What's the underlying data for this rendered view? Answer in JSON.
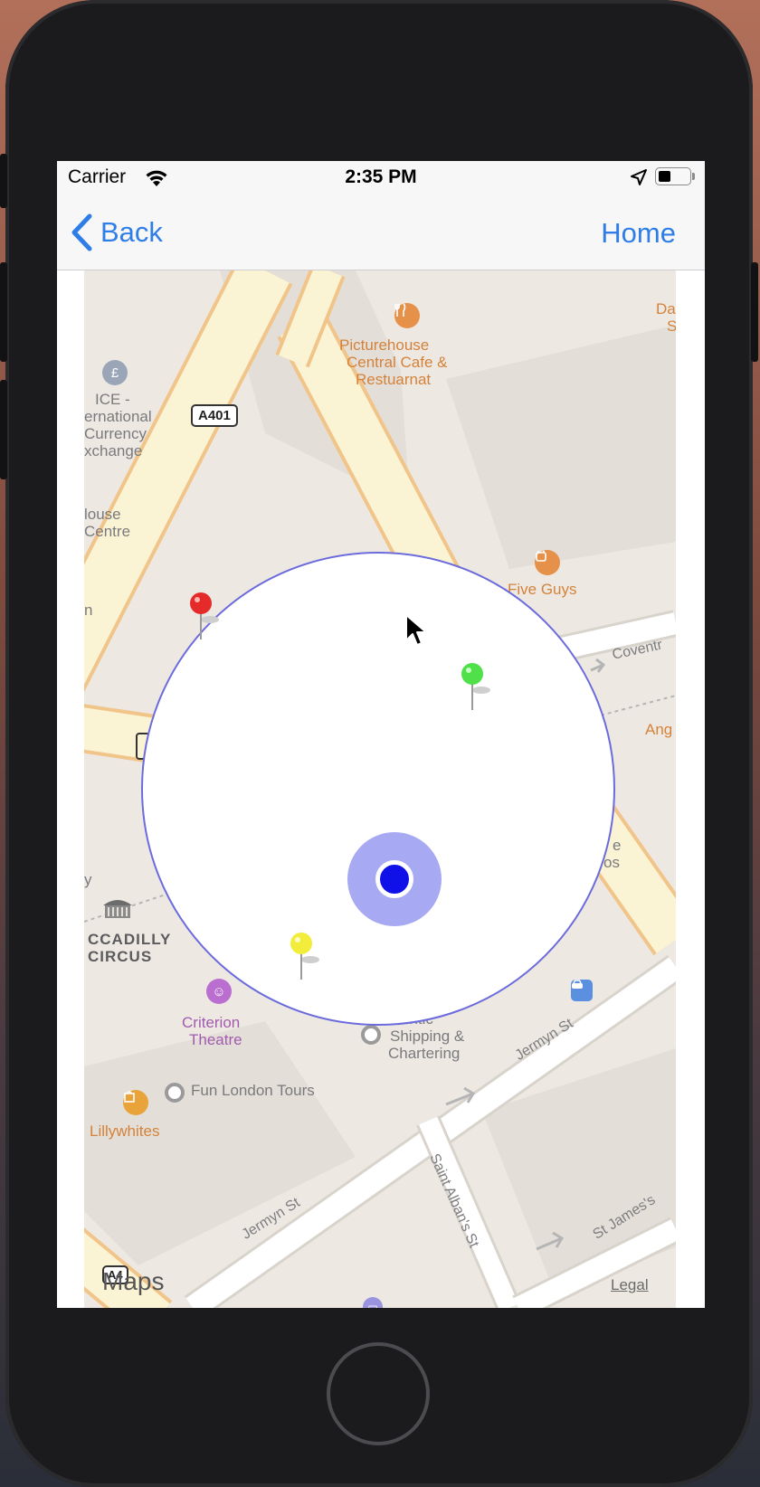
{
  "status_bar": {
    "carrier": "Carrier",
    "time": "2:35 PM",
    "icons": [
      "wifi-icon",
      "location-arrow-icon",
      "battery-icon"
    ]
  },
  "nav_bar": {
    "back_label": "Back",
    "home_label": "Home",
    "tint_color": "#2f7ee8"
  },
  "map": {
    "pois": {
      "picturehouse_line1": "Picturehouse",
      "picturehouse_line2": "Central Cafe &",
      "picturehouse_line3": "Restuarnat",
      "ice_line1": "ICE -",
      "ice_line2": "ernational",
      "ice_line3": "Currency",
      "ice_line4": "xchange",
      "house_line1": "louse",
      "house_line2": "Centre",
      "five_guys": "Five Guys",
      "piccadilly_line1": "CCADILLY",
      "piccadilly_line2": "CIRCUS",
      "criterion_line1": "Criterion",
      "criterion_line2": "Theatre",
      "shipping_line1": "antic",
      "shipping_line2": "Shipping &",
      "shipping_line3": "Chartering",
      "fun_london": "Fun London Tours",
      "lillywhites": "Lillywhites",
      "da_line1": "Da",
      "da_line2": "S",
      "ang": "Ang",
      "edge_n": "n",
      "edge_y": "y",
      "edge_e": "e",
      "edge_os": "os"
    },
    "streets": {
      "coventry": "Coventr",
      "jermyn_st_1": "Jermyn St",
      "jermyn_st_2": "Jermyn St",
      "saint_albans": "Saint Alban's St",
      "st_james": "St James's"
    },
    "road_shields": {
      "a401": "A401",
      "a4": "A4"
    },
    "attribution": {
      "logo": "Maps",
      "legal": "Legal"
    },
    "overlay": {
      "stroke_color": "#6b6bdd",
      "fill_color": "#ffffff"
    },
    "user_location": {
      "dot_color": "#1010e8",
      "halo_color": "#a7a9f2"
    },
    "pins": [
      {
        "color": "red",
        "hex": "#e52a2a"
      },
      {
        "color": "green",
        "hex": "#4fe04a"
      },
      {
        "color": "yellow",
        "hex": "#f2ec3a"
      }
    ]
  }
}
